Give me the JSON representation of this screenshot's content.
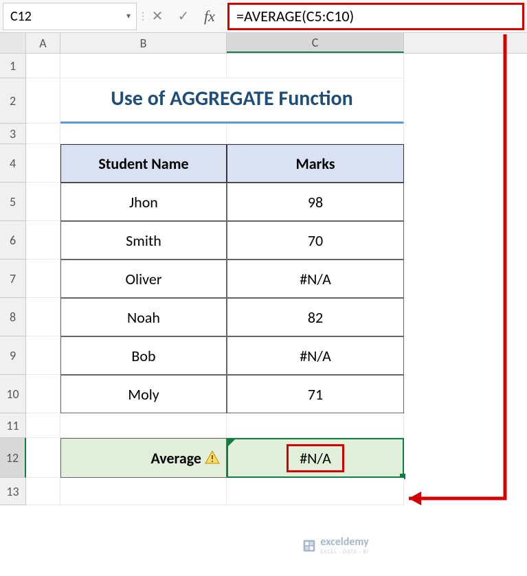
{
  "formula_bar": {
    "cell_ref": "C12",
    "formula": "=AVERAGE(C5:C10)"
  },
  "columns": [
    "A",
    "B",
    "C"
  ],
  "rows": [
    "1",
    "2",
    "3",
    "4",
    "5",
    "6",
    "7",
    "8",
    "9",
    "10",
    "11",
    "12",
    "13"
  ],
  "title": "Use of AGGREGATE Function",
  "table": {
    "headers": {
      "col_b": "Student Name",
      "col_c": "Marks"
    },
    "rows": [
      {
        "name": "Jhon",
        "marks": "98"
      },
      {
        "name": "Smith",
        "marks": "70"
      },
      {
        "name": "Oliver",
        "marks": "#N/A"
      },
      {
        "name": "Noah",
        "marks": "82"
      },
      {
        "name": "Bob",
        "marks": "#N/A"
      },
      {
        "name": "Moly",
        "marks": "71"
      }
    ]
  },
  "average": {
    "label": "Average",
    "value": "#N/A"
  },
  "watermark": {
    "name": "exceldemy",
    "tagline": "EXCEL · DATA · BI"
  }
}
